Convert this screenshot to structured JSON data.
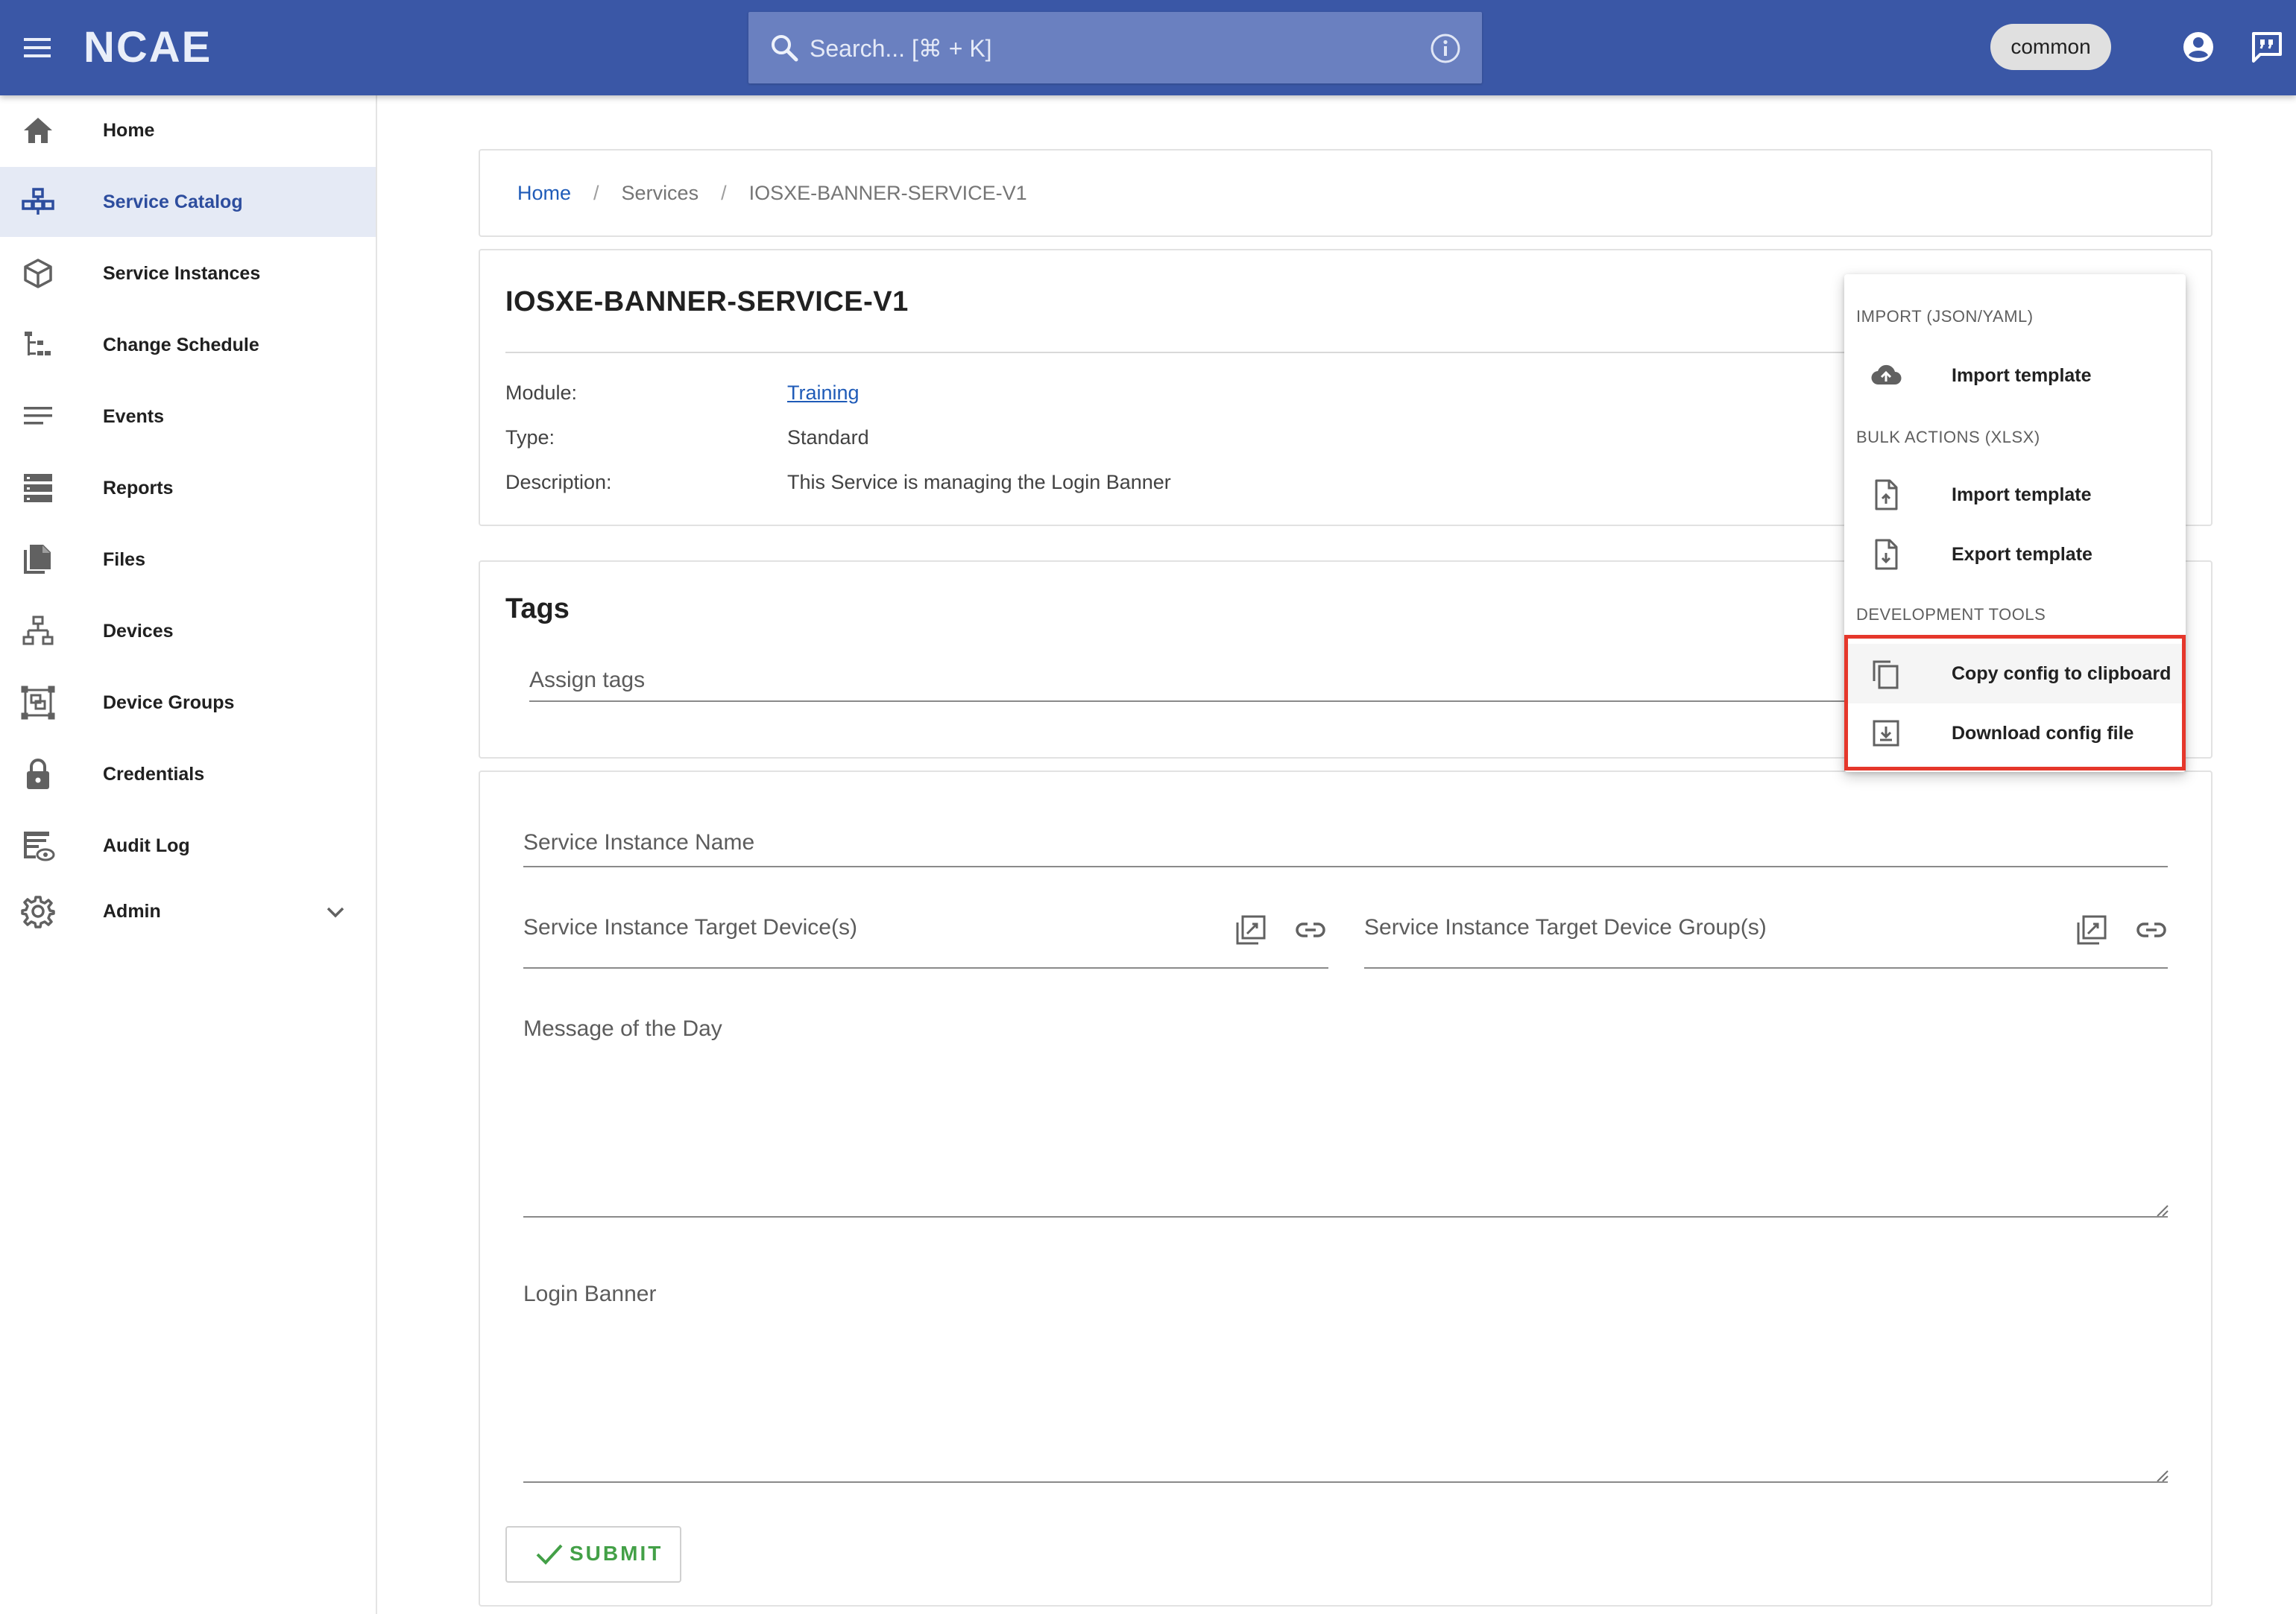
{
  "header": {
    "logo_text": "NCAE",
    "search_placeholder": "Search... [⌘ + K]",
    "environment_chip": "common",
    "colors": {
      "bar": "#3a57a6",
      "search_bg": "#6a80c0"
    }
  },
  "sidebar": {
    "items": [
      {
        "label": "Home",
        "icon": "home-icon"
      },
      {
        "label": "Service Catalog",
        "icon": "service-catalog-icon",
        "active": true
      },
      {
        "label": "Service Instances",
        "icon": "cube-icon"
      },
      {
        "label": "Change Schedule",
        "icon": "tree-schedule-icon"
      },
      {
        "label": "Events",
        "icon": "list-lines-icon"
      },
      {
        "label": "Reports",
        "icon": "reports-stack-icon"
      },
      {
        "label": "Files",
        "icon": "files-icon"
      },
      {
        "label": "Devices",
        "icon": "network-devices-icon"
      },
      {
        "label": "Device Groups",
        "icon": "device-groups-icon"
      },
      {
        "label": "Credentials",
        "icon": "lock-icon"
      },
      {
        "label": "Audit Log",
        "icon": "audit-log-icon"
      },
      {
        "label": "Admin",
        "icon": "gear-icon",
        "expandable": true
      }
    ],
    "active_color": "#2d4d9e",
    "active_bg": "#e5eaf5"
  },
  "breadcrumb": {
    "home": "Home",
    "section": "Services",
    "current": "IOSXE-BANNER-SERVICE-V1",
    "separator": "/"
  },
  "service": {
    "title": "IOSXE-BANNER-SERVICE-V1",
    "module_label": "Module:",
    "module_value": "Training",
    "type_label": "Type:",
    "type_value": "Standard",
    "description_label": "Description:",
    "description_value": "This Service is managing the Login Banner"
  },
  "tags": {
    "title": "Tags",
    "input_label": "Assign tags"
  },
  "form": {
    "instance_name_label": "Service Instance Name",
    "target_devices_label": "Service Instance Target Device(s)",
    "target_groups_label": "Service Instance Target Device Group(s)",
    "motd_label": "Message of the Day",
    "login_banner_label": "Login Banner",
    "submit_label": "SUBMIT",
    "submit_color": "#43a047"
  },
  "menu": {
    "sections": [
      {
        "header": "IMPORT (JSON/YAML)",
        "items": [
          {
            "label": "Import template",
            "icon": "cloud-upload-icon"
          }
        ]
      },
      {
        "header": "BULK ACTIONS (XLSX)",
        "items": [
          {
            "label": "Import template",
            "icon": "file-upload-icon"
          },
          {
            "label": "Export template",
            "icon": "file-download-icon"
          }
        ]
      },
      {
        "header": "DEVELOPMENT TOOLS",
        "items": [
          {
            "label": "Copy config to clipboard",
            "icon": "copy-icon"
          },
          {
            "label": "Download config file",
            "icon": "download-box-icon"
          }
        ]
      }
    ],
    "highlight_color": "#e5372b"
  }
}
